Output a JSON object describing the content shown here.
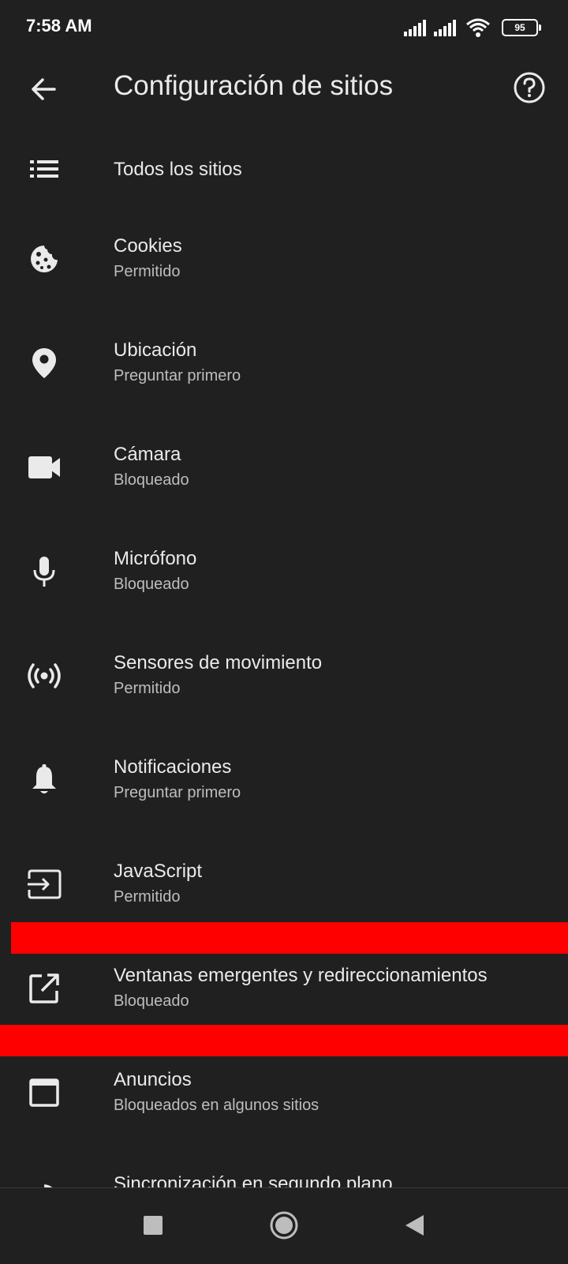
{
  "status_bar": {
    "time": "7:58 AM",
    "battery": "95"
  },
  "header": {
    "title": "Configuración de sitios"
  },
  "items": [
    {
      "label": "Todos los sitios",
      "sub": "",
      "icon": "list-icon"
    },
    {
      "label": "Cookies",
      "sub": "Permitido",
      "icon": "cookie-icon"
    },
    {
      "label": "Ubicación",
      "sub": "Preguntar primero",
      "icon": "location-pin-icon"
    },
    {
      "label": "Cámara",
      "sub": "Bloqueado",
      "icon": "camera-icon"
    },
    {
      "label": "Micrófono",
      "sub": "Bloqueado",
      "icon": "microphone-icon"
    },
    {
      "label": "Sensores de movimiento",
      "sub": "Permitido",
      "icon": "motion-sensor-icon"
    },
    {
      "label": "Notificaciones",
      "sub": "Preguntar primero",
      "icon": "bell-icon"
    },
    {
      "label": "JavaScript",
      "sub": "Permitido",
      "icon": "javascript-icon"
    },
    {
      "label": "Ventanas emergentes y redireccionamientos",
      "sub": "Bloqueado",
      "icon": "popup-icon"
    },
    {
      "label": "Anuncios",
      "sub": "Bloqueados en algunos sitios",
      "icon": "ads-icon"
    },
    {
      "label": "Sincronización en segundo plano",
      "sub": "",
      "icon": "sync-icon"
    }
  ],
  "colors": {
    "background": "#202020",
    "highlight": "#ff0000",
    "text_primary": "#eaeaea",
    "text_secondary": "#bdbdbd"
  }
}
